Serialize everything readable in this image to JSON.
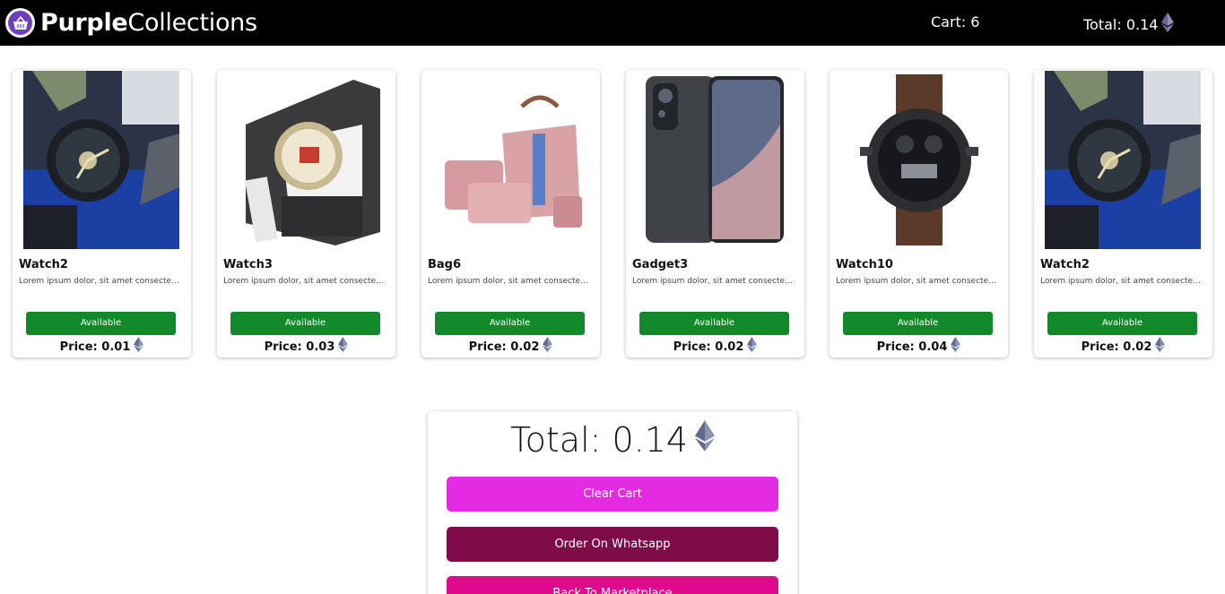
{
  "header": {
    "brand_bold": "Purple",
    "brand_light": "Collections",
    "cart_label": "Cart: 6",
    "total_label": "Total: 0.14"
  },
  "products": [
    {
      "name": "Watch2",
      "description": "Lorem ipsum dolor, sit amet consectetur adipisicing elit.",
      "status": "Available",
      "price": "Price: 0.01",
      "image": "watch2-image"
    },
    {
      "name": "Watch3",
      "description": "Lorem ipsum dolor, sit amet consectetur adipisicing elit.",
      "status": "Available",
      "price": "Price: 0.03",
      "image": "watch3-image"
    },
    {
      "name": "Bag6",
      "description": "Lorem ipsum dolor, sit amet consectetur adipisicing elit.",
      "status": "Available",
      "price": "Price: 0.02",
      "image": "bag6-image"
    },
    {
      "name": "Gadget3",
      "description": "Lorem ipsum dolor, sit amet consectetur adipisicing elit.",
      "status": "Available",
      "price": "Price: 0.02",
      "image": "gadget3-image"
    },
    {
      "name": "Watch10",
      "description": "Lorem ipsum dolor, sit amet consectetur adipisicing elit.",
      "status": "Available",
      "price": "Price: 0.04",
      "image": "watch10-image"
    },
    {
      "name": "Watch2",
      "description": "Lorem ipsum dolor, sit amet consectetur adipisicing elit.",
      "status": "Available",
      "price": "Price: 0.02",
      "image": "watch2-image"
    }
  ],
  "summary": {
    "total_label": "Total: 0.14",
    "clear_label": "Clear Cart",
    "order_label": "Order On Whatsapp",
    "back_label": "Back To Marketplace"
  },
  "colors": {
    "navbar": "#000000",
    "available": "#128a2b",
    "clear": "#e22be2",
    "order": "#7d0c48",
    "back": "#df0a8c",
    "brand": "#6d3fbf"
  },
  "icons": {
    "currency": "ethereum-icon",
    "logo": "shopping-basket-icon"
  }
}
